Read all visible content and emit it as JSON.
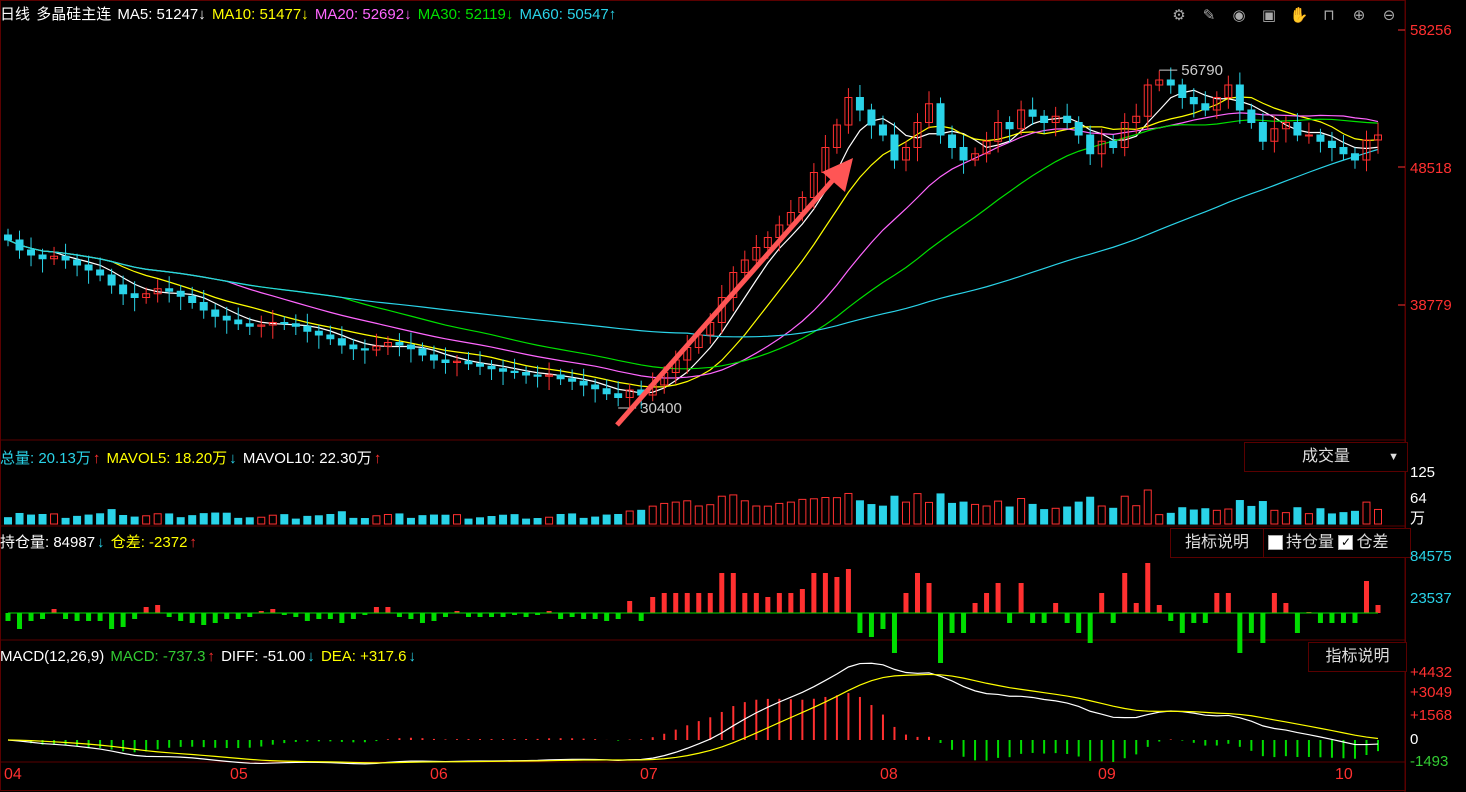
{
  "header": {
    "period": "日线",
    "name": "多晶硅主连",
    "ma": [
      {
        "label": "MA5: 51247",
        "arrow": "↓",
        "color": "#ffffff"
      },
      {
        "label": "MA10: 51477",
        "arrow": "↓",
        "color": "#ffff00"
      },
      {
        "label": "MA20: 52692",
        "arrow": "↓",
        "color": "#ff66ff"
      },
      {
        "label": "MA30: 52119",
        "arrow": "↓",
        "color": "#00e000"
      },
      {
        "label": "MA60: 50547",
        "arrow": "↑",
        "color": "#2ad3e8"
      }
    ]
  },
  "toolbar_icons": [
    "gear-icon",
    "brush-icon",
    "eye-icon",
    "toolbox-icon",
    "hand-icon",
    "lock-icon",
    "zoom-in-icon",
    "zoom-out-icon"
  ],
  "price_axis": [
    "58256",
    "48518",
    "38779"
  ],
  "annotations": {
    "high": "56790",
    "low": "30400"
  },
  "volume": {
    "header_total": "总量: 20.13万",
    "header_total_arrow": "↑",
    "mavol5": "MAVOL5: 18.20万",
    "mavol5_arrow": "↓",
    "mavol10": "MAVOL10: 22.30万",
    "mavol10_arrow": "↑",
    "dropdown": "成交量",
    "axis": [
      "125",
      "64",
      "万"
    ]
  },
  "oi": {
    "label": "持仓量: 84987",
    "label_arrow": "↓",
    "diff": "仓差: -2372",
    "diff_arrow": "↑",
    "button": "指标说明",
    "check1": "持仓量",
    "check2": "仓差",
    "axis": [
      "84575",
      "23537"
    ]
  },
  "macd": {
    "label": "MACD(12,26,9)",
    "macd": "MACD: -737.3",
    "macd_arrow": "↑",
    "diff": "DIFF: -51.00",
    "diff_arrow": "↓",
    "dea": "DEA: +317.6",
    "dea_arrow": "↓",
    "button": "指标说明",
    "axis": [
      "+4432",
      "+3049",
      "+1568",
      "0",
      "-1493"
    ]
  },
  "months": [
    "04",
    "05",
    "06",
    "07",
    "08",
    "09",
    "10"
  ],
  "colors": {
    "up": "#ff3030",
    "down": "#2ad3e8",
    "grid": "#5a0000",
    "bg": "#000000"
  },
  "chart_data": {
    "type": "candlestick",
    "price_range": [
      28000,
      60000
    ],
    "closes": [
      43200,
      42400,
      42000,
      41700,
      41900,
      41600,
      41200,
      40800,
      40400,
      39600,
      38900,
      38600,
      38900,
      39300,
      39100,
      38700,
      38200,
      37600,
      37100,
      36800,
      36500,
      36300,
      36400,
      36600,
      36500,
      36300,
      35900,
      35600,
      35300,
      34800,
      34500,
      34400,
      34700,
      35000,
      34800,
      34500,
      34000,
      33600,
      33400,
      33500,
      33300,
      33100,
      32900,
      32700,
      32600,
      32400,
      32300,
      32400,
      32100,
      31900,
      31600,
      31300,
      30900,
      30600,
      31200,
      30800,
      31600,
      32600,
      33600,
      34600,
      35600,
      36600,
      38600,
      40600,
      41600,
      42600,
      43400,
      44400,
      45400,
      46600,
      48600,
      50600,
      52400,
      54600,
      53600,
      52400,
      51600,
      49600,
      50600,
      52600,
      54100,
      51600,
      50600,
      49600,
      50100,
      51100,
      52600,
      52100,
      53600,
      53100,
      52600,
      53100,
      52600,
      51600,
      50100,
      51100,
      50600,
      52600,
      53100,
      55600,
      56000,
      55600,
      54600,
      54100,
      53600,
      54600,
      55600,
      53600,
      52600,
      51100,
      52100,
      52600,
      51600,
      51600,
      51100,
      50600,
      50100,
      49600,
      51200,
      51600
    ],
    "volume_range": [
      0,
      125
    ],
    "oi_range": [
      20000,
      90000
    ],
    "macd_range": [
      -1500,
      4800
    ]
  }
}
